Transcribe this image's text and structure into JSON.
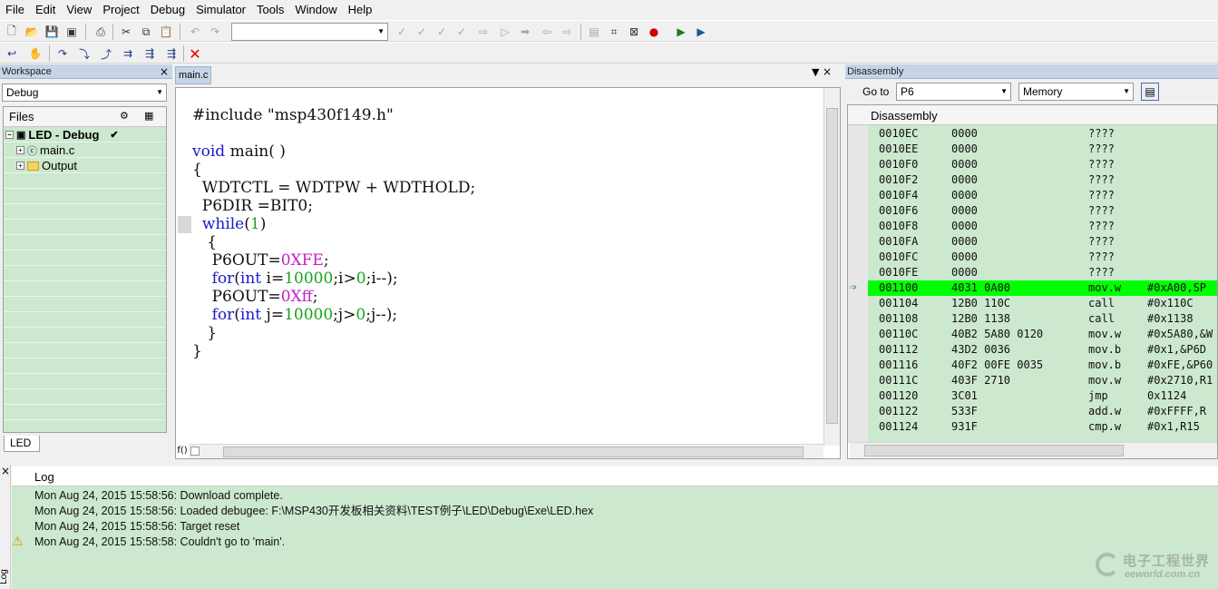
{
  "menu": [
    "File",
    "Edit",
    "View",
    "Project",
    "Debug",
    "Simulator",
    "Tools",
    "Window",
    "Help"
  ],
  "workspace": {
    "title": "Workspace",
    "config": "Debug",
    "files_header": "Files",
    "tree": [
      {
        "label": "LED - Debug",
        "check": "✔"
      },
      {
        "label": "main.c"
      },
      {
        "label": "Output"
      }
    ],
    "tab": "LED"
  },
  "editor": {
    "tab": "main.c",
    "code": [
      {
        "parts": [
          {
            "t": "#include \"msp430f149.h\"",
            "c": "str"
          }
        ]
      },
      {
        "parts": []
      },
      {
        "parts": [
          {
            "t": "void",
            "c": "kw"
          },
          {
            "t": " main( )",
            "c": "str"
          }
        ]
      },
      {
        "parts": [
          {
            "t": "{",
            "c": "str"
          }
        ]
      },
      {
        "parts": [
          {
            "t": "  WDTCTL = WDTPW + WDTHOLD;",
            "c": "str"
          }
        ]
      },
      {
        "parts": [
          {
            "t": "  P6DIR =BIT0;",
            "c": "str"
          }
        ]
      },
      {
        "parts": [
          {
            "t": "  ",
            "c": "str"
          },
          {
            "t": "while",
            "c": "kw"
          },
          {
            "t": "(",
            "c": "str"
          },
          {
            "t": "1",
            "c": "num"
          },
          {
            "t": ")",
            "c": "str"
          }
        ]
      },
      {
        "parts": [
          {
            "t": "   {",
            "c": "str"
          }
        ]
      },
      {
        "parts": [
          {
            "t": "    P6OUT=",
            "c": "str"
          },
          {
            "t": "0XFE",
            "c": "hex"
          },
          {
            "t": ";",
            "c": "str"
          }
        ]
      },
      {
        "parts": [
          {
            "t": "    ",
            "c": "str"
          },
          {
            "t": "for",
            "c": "kw"
          },
          {
            "t": "(",
            "c": "str"
          },
          {
            "t": "int",
            "c": "kw"
          },
          {
            "t": " i=",
            "c": "str"
          },
          {
            "t": "10000",
            "c": "num"
          },
          {
            "t": ";i>",
            "c": "str"
          },
          {
            "t": "0",
            "c": "num"
          },
          {
            "t": ";i--);",
            "c": "str"
          }
        ]
      },
      {
        "parts": [
          {
            "t": "    P6OUT=",
            "c": "str"
          },
          {
            "t": "0Xff",
            "c": "hex"
          },
          {
            "t": ";",
            "c": "str"
          }
        ]
      },
      {
        "parts": [
          {
            "t": "    ",
            "c": "str"
          },
          {
            "t": "for",
            "c": "kw"
          },
          {
            "t": "(",
            "c": "str"
          },
          {
            "t": "int",
            "c": "kw"
          },
          {
            "t": " j=",
            "c": "str"
          },
          {
            "t": "10000",
            "c": "num"
          },
          {
            "t": ";j>",
            "c": "str"
          },
          {
            "t": "0",
            "c": "num"
          },
          {
            "t": ";j--);",
            "c": "str"
          }
        ]
      },
      {
        "parts": [
          {
            "t": "   }",
            "c": "str"
          }
        ]
      },
      {
        "parts": [
          {
            "t": "}",
            "c": "str"
          }
        ]
      }
    ],
    "status_icon": "f()"
  },
  "disassembly": {
    "title": "Disassembly",
    "goto_label": "Go to",
    "goto_value": "P6",
    "memory_select": "Memory",
    "header": "Disassembly",
    "rows": [
      {
        "addr": "0010EC",
        "code": "0000",
        "mn": "????",
        "op": ""
      },
      {
        "addr": "0010EE",
        "code": "0000",
        "mn": "????",
        "op": ""
      },
      {
        "addr": "0010F0",
        "code": "0000",
        "mn": "????",
        "op": ""
      },
      {
        "addr": "0010F2",
        "code": "0000",
        "mn": "????",
        "op": ""
      },
      {
        "addr": "0010F4",
        "code": "0000",
        "mn": "????",
        "op": ""
      },
      {
        "addr": "0010F6",
        "code": "0000",
        "mn": "????",
        "op": ""
      },
      {
        "addr": "0010F8",
        "code": "0000",
        "mn": "????",
        "op": ""
      },
      {
        "addr": "0010FA",
        "code": "0000",
        "mn": "????",
        "op": ""
      },
      {
        "addr": "0010FC",
        "code": "0000",
        "mn": "????",
        "op": ""
      },
      {
        "addr": "0010FE",
        "code": "0000",
        "mn": "????",
        "op": ""
      },
      {
        "addr": "001100",
        "code": "4031 0A00",
        "mn": "mov.w",
        "op": "#0xA00,SP",
        "current": true
      },
      {
        "addr": "001104",
        "code": "12B0 110C",
        "mn": "call",
        "op": "#0x110C"
      },
      {
        "addr": "001108",
        "code": "12B0 1138",
        "mn": "call",
        "op": "#0x1138"
      },
      {
        "addr": "00110C",
        "code": "40B2 5A80 0120",
        "mn": "mov.w",
        "op": "#0x5A80,&W"
      },
      {
        "addr": "001112",
        "code": "43D2 0036",
        "mn": "mov.b",
        "op": "#0x1,&P6D"
      },
      {
        "addr": "001116",
        "code": "40F2 00FE 0035",
        "mn": "mov.b",
        "op": "#0xFE,&P60"
      },
      {
        "addr": "00111C",
        "code": "403F 2710",
        "mn": "mov.w",
        "op": "#0x2710,R1"
      },
      {
        "addr": "001120",
        "code": "3C01",
        "mn": "jmp",
        "op": "0x1124"
      },
      {
        "addr": "001122",
        "code": "533F",
        "mn": "add.w",
        "op": "#0xFFFF,R"
      },
      {
        "addr": "001124",
        "code": "931F",
        "mn": "cmp.w",
        "op": "#0x1,R15"
      }
    ]
  },
  "log": {
    "header": "Log",
    "side_label": "Log",
    "lines": [
      {
        "text": "Mon Aug 24, 2015 15:58:56: Download complete.",
        "warn": false
      },
      {
        "text": "Mon Aug 24, 2015 15:58:56: Loaded debugee: F:\\MSP430开发板相关资料\\TEST例子\\LED\\Debug\\Exe\\LED.hex",
        "warn": false
      },
      {
        "text": "Mon Aug 24, 2015 15:58:56: Target reset",
        "warn": false
      },
      {
        "text": "Mon Aug 24, 2015 15:58:58: Couldn't go to 'main'.",
        "warn": true
      }
    ]
  },
  "watermark": {
    "line1": "电子工程世界",
    "line2": "eeworld.com.cn"
  },
  "colors": {
    "green_pane": "#cce8cf",
    "current_line": "#00ff00",
    "keyword": "#1a1acc",
    "number": "#1aa31a",
    "hex": "#c71cc7"
  }
}
